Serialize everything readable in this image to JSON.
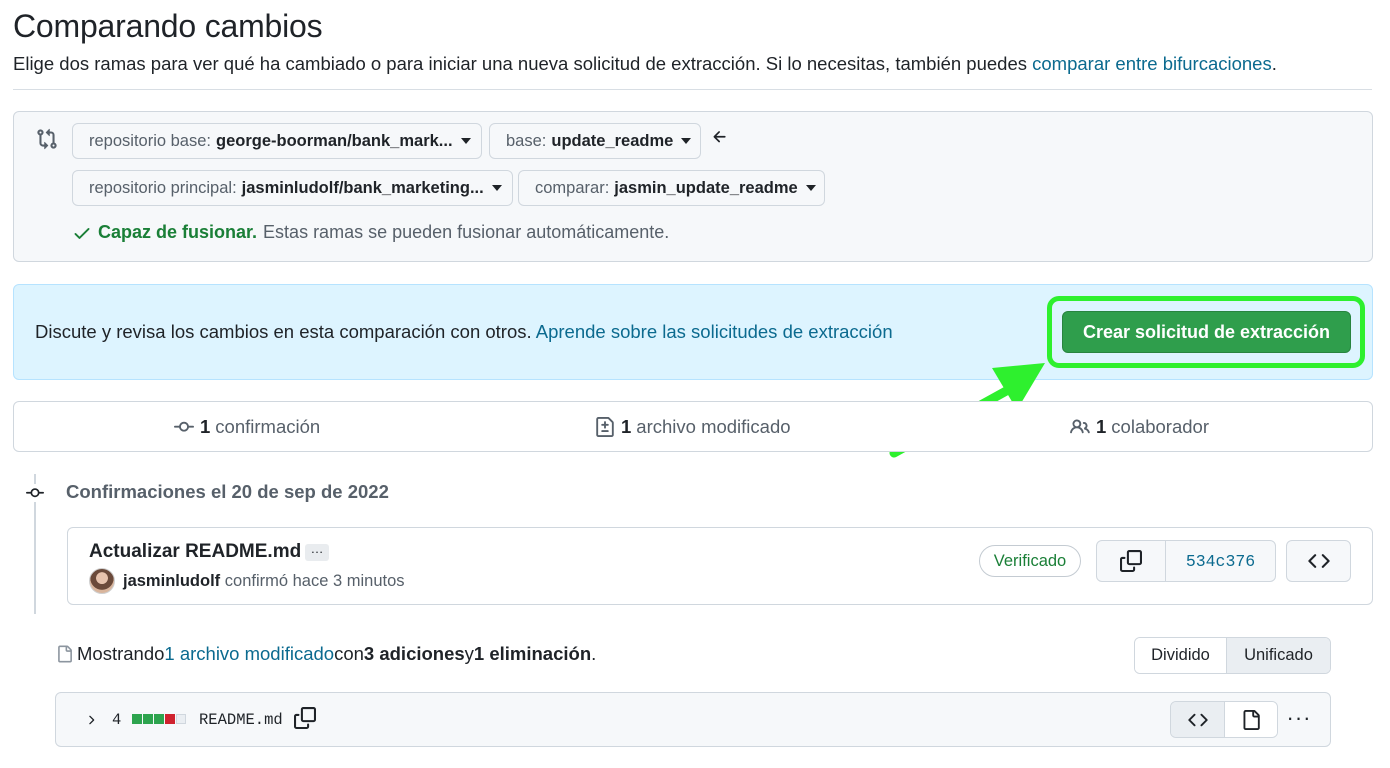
{
  "header": {
    "title": "Comparando cambios",
    "subtitle_text": "Elige dos ramas para ver qué ha cambiado o para iniciar una nueva solicitud de extracción. Si lo necesitas, también puedes ",
    "subtitle_link": "comparar entre bifurcaciones",
    "subtitle_end": "."
  },
  "range": {
    "base_repo_label": "repositorio base:",
    "base_repo_value": "george-boorman/bank_mark...",
    "base_label": "base:",
    "base_value": "update_readme",
    "head_repo_label": "repositorio principal:",
    "head_repo_value": "jasminludolf/bank_marketing...",
    "compare_label": "comparar:",
    "compare_value": "jasmin_update_readme",
    "merge_ok": "Capaz de fusionar.",
    "merge_text": "Estas ramas se pueden fusionar automáticamente."
  },
  "discuss": {
    "text": "Discute y revisa los cambios en esta comparación con otros. ",
    "link": "Aprende sobre las solicitudes de extracción",
    "create_button": "Crear solicitud de extracción"
  },
  "summary": {
    "commits_count": "1",
    "commits_label": "confirmación",
    "files_count": "1",
    "files_label": "archivo modificado",
    "contributors_count": "1",
    "contributors_label": "colaborador"
  },
  "timeline": {
    "date_label": "Confirmaciones el 20 de sep de 2022"
  },
  "commit": {
    "title": "Actualizar README.md",
    "ellipsis": "…",
    "author": "jasminludolf",
    "meta": "confirmó hace 3 minutos",
    "verified": "Verificado",
    "sha": "534c376"
  },
  "toc": {
    "prefix": "Mostrando ",
    "files_link": "1 archivo modificado",
    "mid1": " con ",
    "additions": "3 adiciones",
    "mid2": " y ",
    "deletions": "1 eliminación",
    "end": ".",
    "split": "Dividido",
    "unified": "Unificado"
  },
  "file": {
    "changes": "4",
    "name": "README.md",
    "diffstat": [
      "add",
      "add",
      "add",
      "del",
      "neu"
    ],
    "kebab": "···"
  },
  "colors": {
    "accent_green": "#2f9e4c",
    "highlight": "#2ef02e",
    "link": "#0b6a8f",
    "info_bg": "#ddf4ff"
  }
}
